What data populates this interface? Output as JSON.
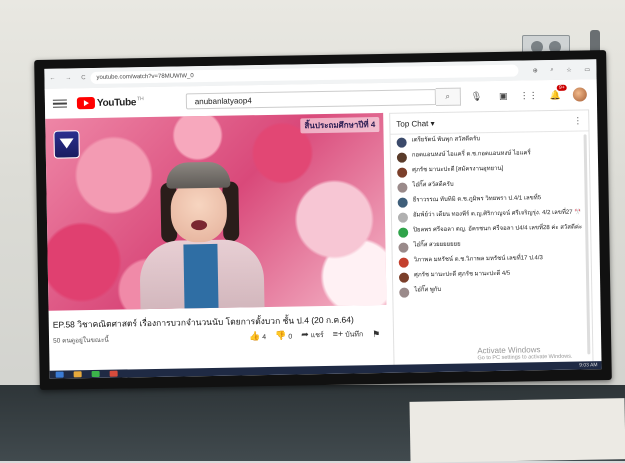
{
  "browser": {
    "url": "youtube.com/watch?v=78MUWIW_0",
    "nav": [
      "←",
      "→",
      "C"
    ],
    "ext": [
      "⊕",
      "⌕",
      "☆",
      "▭"
    ]
  },
  "header": {
    "logo": "YouTube",
    "logo_sup": "TH",
    "search_value": "anubanlatyaop4",
    "notif_count": "9+",
    "icons": [
      "menu-icon",
      "search-icon",
      "mic-icon",
      "create-icon",
      "apps-icon",
      "bell-icon",
      "avatar"
    ]
  },
  "video": {
    "watermark": "สิ้นประถมศึกษาปีที่ 4",
    "title": "EP.58 วิชาคณิตศาสตร์ เรื่องการบวกจำนวนนับ โดยการตั้งบวก ชั้น ป.4 (20 ก.ค.64)",
    "meta": "50 คนดูอยู่ในขณะนี้",
    "likes": "4",
    "dislikes": "0",
    "share": "แชร์",
    "save": "บันทึก"
  },
  "chat": {
    "title": "Top Chat",
    "messages": [
      {
        "author": "",
        "text": "เตรียรัตน์ พันพุก สวัสดีครับ",
        "color": "#3b4a6b"
      },
      {
        "author": "",
        "text": "กอดแอนหงษ์ ไอแครี่ ด.ช.กอดแอนหงษ์ ไอแครี่",
        "color": "#5a3b2a"
      },
      {
        "author": "",
        "text": "ศุภรัช มานะปะตี [สมัครงานอุทยาน]",
        "color": "#7b3f2a"
      },
      {
        "author": "",
        "text": "ไอ๋กิ๊ส สวัสดีครับ",
        "color": "#9a8a8a"
      },
      {
        "author": "",
        "text": "ธีราวรรณ ทับทิมิ ด.ช.ภูมิพร วิทยพรา ป.4/1 เลขที่5",
        "color": "#3f5f7a"
      },
      {
        "author": "",
        "text": "อัมพ์ย์ว่า เดียน ทองพีร์ ด.ญ.ศิริกาญจน์ ศรีเจริญรุ่ง. 4/2 เลขที่27 🎌",
        "color": "#b0b0b0"
      },
      {
        "author": "",
        "text": "ปิยลพร ศรีจอลา ตญ. อัครชนก ศรีจอลา ป4/4 เลขที่28 ค่ะ สวัสดีค่ะ",
        "color": "#2fa34a"
      },
      {
        "author": "",
        "text": "ไอ๋กิ๊ส สวยยยยยยย",
        "color": "#9a8a8a"
      },
      {
        "author": "",
        "text": "วิภาพล มหรัชน์ ด.ช.วิภาพล มหรัชน์ เลขที่17 ป.4/3",
        "color": "#c4402e"
      },
      {
        "author": "",
        "text": "ศุภรัช มานะปะตี ศุภรัช มานะปะตี 4/5",
        "color": "#7b3f2a"
      },
      {
        "author": "",
        "text": "ไอ๋กิ๊ส พูกับ",
        "color": "#9a8a8a"
      }
    ]
  },
  "overlay": {
    "activate": "Activate Windows",
    "activate_sub": "Go to PC settings to activate Windows."
  },
  "taskbar": {
    "clock": "9:03 AM"
  }
}
